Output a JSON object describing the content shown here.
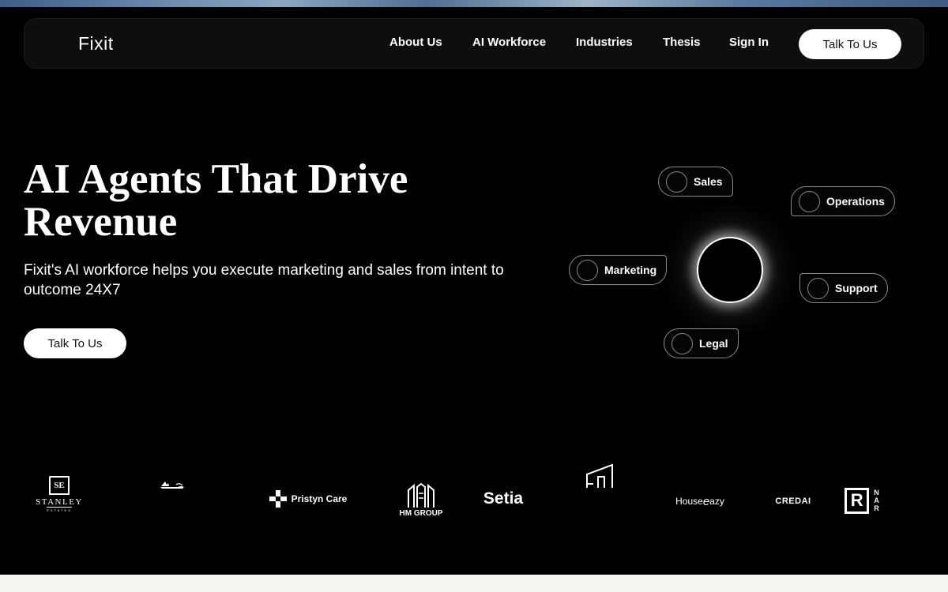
{
  "nav": {
    "brand": "Fixit",
    "links": [
      "About Us",
      "AI Workforce",
      "Industries",
      "Thesis",
      "Sign In"
    ],
    "cta": "Talk To Us"
  },
  "hero": {
    "title_line1": "AI Agents That Drive",
    "title_line2": "Revenue",
    "subtitle": "Fixit's AI workforce helps you execute marketing and sales from intent to outcome 24X7",
    "cta": "Talk To Us"
  },
  "agents": [
    "Sales",
    "Operations",
    "Marketing",
    "Support",
    "Legal"
  ],
  "logos": {
    "stanley": {
      "name": "STANLEY",
      "tagline": "ESTATES",
      "monogram": "SE"
    },
    "pristyn": "Pristyn Care",
    "hm_group": "HM GROUP",
    "setia": "Setia",
    "houseeazy": {
      "prefix": "House",
      "mark": "e",
      "suffix": "azy"
    },
    "credai": "CREDAI",
    "nar": {
      "mark": "R",
      "letters": [
        "N",
        "A",
        "R"
      ]
    }
  },
  "colors": {
    "background": "#000000",
    "navbar": "#0e0e0e",
    "button": "#ffffff",
    "pill_border": "#8a8a8a"
  }
}
